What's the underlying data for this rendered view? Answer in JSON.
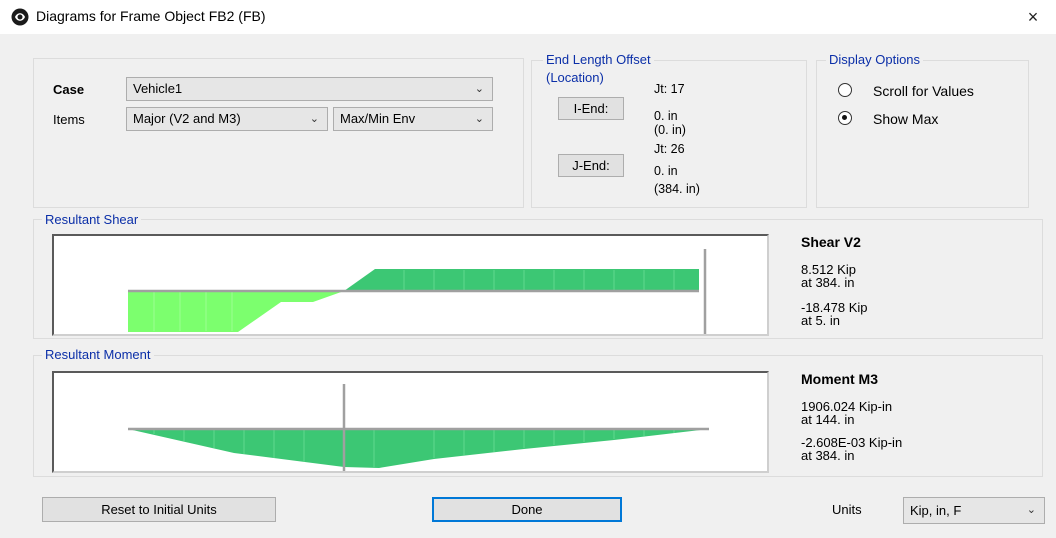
{
  "window": {
    "title": "Diagrams for Frame Object FB2  (FB)",
    "close_glyph": "×"
  },
  "case": {
    "label": "Case",
    "value": "Vehicle1"
  },
  "items": {
    "label": "Items",
    "component": "Major (V2 and M3)",
    "envelope": "Max/Min Env"
  },
  "end_offset": {
    "title": "End Length Offset",
    "subtitle": "(Location)",
    "i_end": {
      "button": "I-End:",
      "joint": "Jt:  17",
      "offset": "0. in",
      "location": "(0. in)"
    },
    "j_end": {
      "button": "J-End:",
      "joint": "Jt:  26",
      "offset": "0. in",
      "location": "(384. in)"
    }
  },
  "display_options": {
    "title": "Display Options",
    "scroll": "Scroll for Values",
    "show_max": "Show Max",
    "selected": "show_max"
  },
  "shear": {
    "group_title": "Resultant Shear",
    "heading": "Shear V2",
    "max_value": "8.512 Kip",
    "max_loc": "at 384. in",
    "min_value": "-18.478 Kip",
    "min_loc": "at 5. in"
  },
  "moment": {
    "group_title": "Resultant Moment",
    "heading": "Moment M3",
    "max_value": "1906.024 Kip-in",
    "max_loc": "at 144. in",
    "min_value": "-2.608E-03 Kip-in",
    "min_loc": "at 384. in"
  },
  "buttons": {
    "reset": "Reset to Initial Units",
    "done": "Done"
  },
  "units": {
    "label": "Units",
    "value": "Kip, in, F"
  },
  "colors": {
    "positive_fill": "#3cc774",
    "negative_fill": "#7cff6e",
    "group_title": "#0b2fa8",
    "focus": "#0078d7"
  }
}
